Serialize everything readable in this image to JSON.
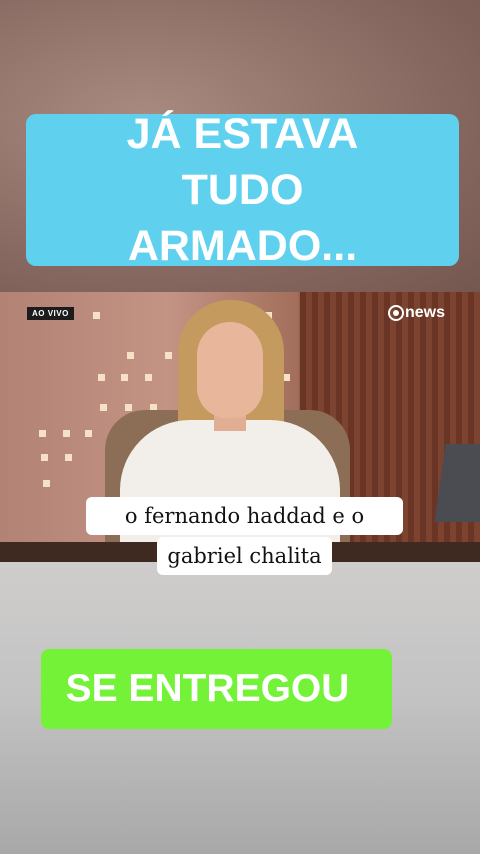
{
  "overlay_top": {
    "text": "JÁ ESTAVA TUDO ARMADO..."
  },
  "video": {
    "live_badge": "AO VIVO",
    "channel_logo_text": "news",
    "subtitle_line1": "o fernando haddad e o",
    "subtitle_line2": "gabriel chalita"
  },
  "overlay_bottom": {
    "text": "SE ENTREGOU"
  },
  "colors": {
    "top_banner": "#5fd1ef",
    "bottom_banner": "#74f238",
    "text": "#ffffff"
  }
}
